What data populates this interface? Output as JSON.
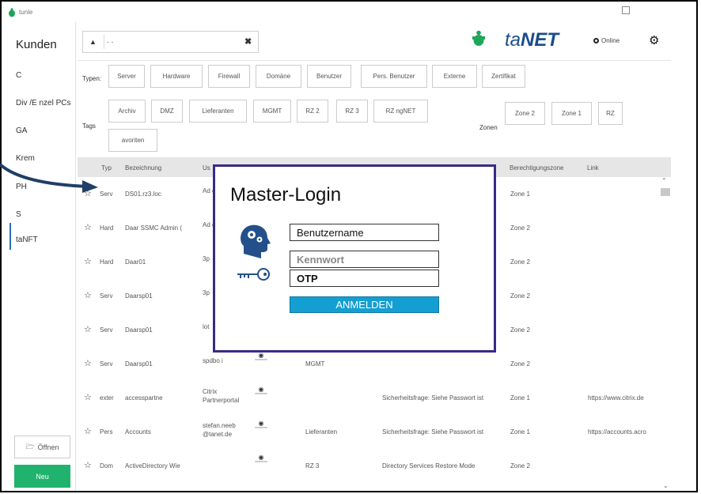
{
  "window": {
    "title": "tunle"
  },
  "sidebar": {
    "title": "Kunden",
    "items": [
      "C",
      "Div /E nzel PCs",
      "GA",
      "Krem",
      "PH",
      "S",
      "taNFT"
    ],
    "open_label": "Öffnen",
    "new_label": "Neu"
  },
  "search": {
    "placeholder": "- -",
    "value": ""
  },
  "brand": {
    "name_light": "ta",
    "name_bold": "NET",
    "status": "Online"
  },
  "filters": {
    "types_label": "Typen:",
    "types": [
      "Server",
      "Hardware",
      "Firewall",
      "Domäne",
      "Benutzer",
      "Pers. Benutzer",
      "Externe",
      "Zertifikat"
    ],
    "tags_label": "Tags",
    "tags": [
      "Archiv",
      "DMZ",
      "Lieferanten",
      "MGMT",
      "RZ 2",
      "RZ 3",
      "RZ ngNET",
      "avoriten"
    ],
    "zones_label": "Zonen",
    "zones": [
      "Zone 2",
      "Zone 1",
      "RZ"
    ]
  },
  "table": {
    "headers": [
      "Typ",
      "Bezeichnung",
      "Us",
      "Berechtigungszone",
      "Link"
    ],
    "rows": [
      {
        "type": "Serv",
        "name": "DS01.rz3.loc",
        "user": "Ad or",
        "pw": "",
        "tags": "",
        "desc": "",
        "zone": "Zone 1",
        "link": ""
      },
      {
        "type": "Hard",
        "name": "Daar SSMC Admin (",
        "user": "Ad or",
        "pw": "",
        "tags": "",
        "desc": "",
        "zone": "Zone 2",
        "link": ""
      },
      {
        "type": "Hard",
        "name": "Daar01",
        "user": "3p",
        "pw": "",
        "tags": "",
        "desc": "",
        "zone": "Zone 2",
        "link": ""
      },
      {
        "type": "Serv",
        "name": "Daarsp01",
        "user": "3p",
        "pw": "",
        "tags": "",
        "desc": "",
        "zone": "Zone 2",
        "link": ""
      },
      {
        "type": "Serv",
        "name": "Daarsp01",
        "user": "lot",
        "pw": "",
        "tags": "",
        "desc": "",
        "zone": "Zone 2",
        "link": ""
      },
      {
        "type": "Serv",
        "name": "Daarsp01",
        "user": "spdbo i",
        "pw": "********",
        "tags": "MGMT",
        "desc": "",
        "zone": "Zone 2",
        "link": ""
      },
      {
        "type": "exter",
        "name": "accesspartne",
        "user": "Citrix Partnerportal",
        "pw": "********",
        "tags": "",
        "desc": "Sicherheitsfrage: Siehe Passwort ist",
        "zone": "Zone 1",
        "link": "https://www.citrix.de"
      },
      {
        "type": "Pers",
        "name": "Accounts",
        "user": "stefan.neeb @tanet.de",
        "pw": "********",
        "tags": "Lieferanten",
        "desc": "Sicherheitsfrage: Siehe Passwort ist",
        "zone": "Zone 1",
        "link": "https://accounts.acro"
      },
      {
        "type": "Dom",
        "name": "ActiveDirectory Wie",
        "user": "",
        "pw": "********",
        "tags": "RZ 3",
        "desc": "Directory Services Restore Mode",
        "zone": "Zone 2",
        "link": ""
      }
    ]
  },
  "login": {
    "title": "Master-Login",
    "username_value": "Benutzername",
    "password_placeholder": "Kennwort",
    "otp_value": "OTP",
    "button_label": "ANMELDEN"
  },
  "colors": {
    "accent_green": "#1fb36d",
    "brand_blue": "#1a4c8c",
    "modal_border": "#3a2a86",
    "login_button": "#149fd3"
  }
}
